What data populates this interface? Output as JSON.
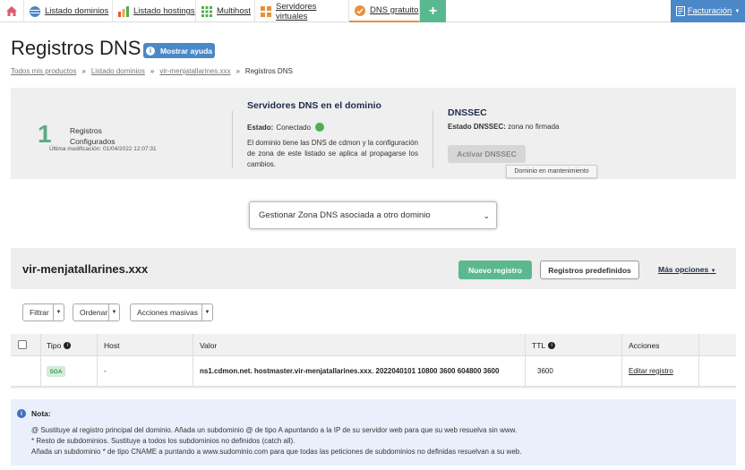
{
  "nav": {
    "tabs": [
      {
        "label": "Listado dominios",
        "icon": "globe-icon"
      },
      {
        "label": "Listado hostings",
        "icon": "bar-chart-icon"
      },
      {
        "label": "Multihost",
        "icon": "grid-icon"
      },
      {
        "label": "Servidores virtuales",
        "icon": "servers-icon"
      },
      {
        "label": "DNS gratuito",
        "icon": "dns-icon"
      }
    ],
    "plus_label": "+",
    "facturacion": "Facturación",
    "colors": {
      "green": "#58b88f",
      "blue": "#4a88c8",
      "active_underline": "#e8913a"
    }
  },
  "page": {
    "title": "Registros DNS",
    "help_label": "Mostrar ayuda"
  },
  "breadcrumb": {
    "items": [
      "Todos mis productos",
      "Listado dominios",
      "vir-menjatallarines.xxx"
    ],
    "separator": "»",
    "current": "Registros DNS"
  },
  "summary": {
    "count": "1",
    "label_line1": "Registros",
    "label_line2": "Configurados",
    "last_modified": "Última modificación: 01/04/2022 12:07:31"
  },
  "dns_servers": {
    "title": "Servidores DNS en el dominio",
    "status_label": "Estado:",
    "status_value": "Conectado",
    "description": "El dominio tiene las DNS de cdmon y la configuración de zona de este listado se aplica al propagarse los cambios."
  },
  "dnssec": {
    "title": "DNSSEC",
    "status_label": "Estado DNSSEC:",
    "status_value": "zona no firmada",
    "button": "Activar DNSSEC",
    "tooltip": "Dominio en mantenimiento"
  },
  "zone_select": {
    "selected": "Gestionar Zona DNS asociada a otro dominio"
  },
  "records": {
    "domain": "vir-menjatallarines.xxx",
    "new_button": "Nuevo registro",
    "predefined_button": "Registros predefinidos",
    "more_options": "Más opciones",
    "filters": {
      "filtrar": "Filtrar",
      "ordenar": "Ordenar",
      "masivas": "Acciones masivas"
    },
    "columns": {
      "tipo": "Tipo",
      "host": "Host",
      "valor": "Valor",
      "ttl": "TTL",
      "acciones": "Acciones"
    },
    "rows": [
      {
        "tipo": "SOA",
        "host": "-",
        "valor": "ns1.cdmon.net. hostmaster.vir-menjatallarines.xxx. 2022040101 10800 3600 604800 3600",
        "ttl": "3600",
        "accion": "Editar registro"
      }
    ]
  },
  "note": {
    "title": "Nota:",
    "lines": [
      "@ Sustituye al registro principal del dominio. Añada un subdominio @ de tipo A apuntando a la IP de su servidor web para que su web resuelva sin www.",
      "* Resto de subdominios. Sustituye a todos los subdominios no definidos (catch all).",
      "Añada un subdominio * de tipo CNAME a puntando a www.sudominio.com para que todas las peticiones de subdominios no definidas resuelvan a su web."
    ]
  }
}
